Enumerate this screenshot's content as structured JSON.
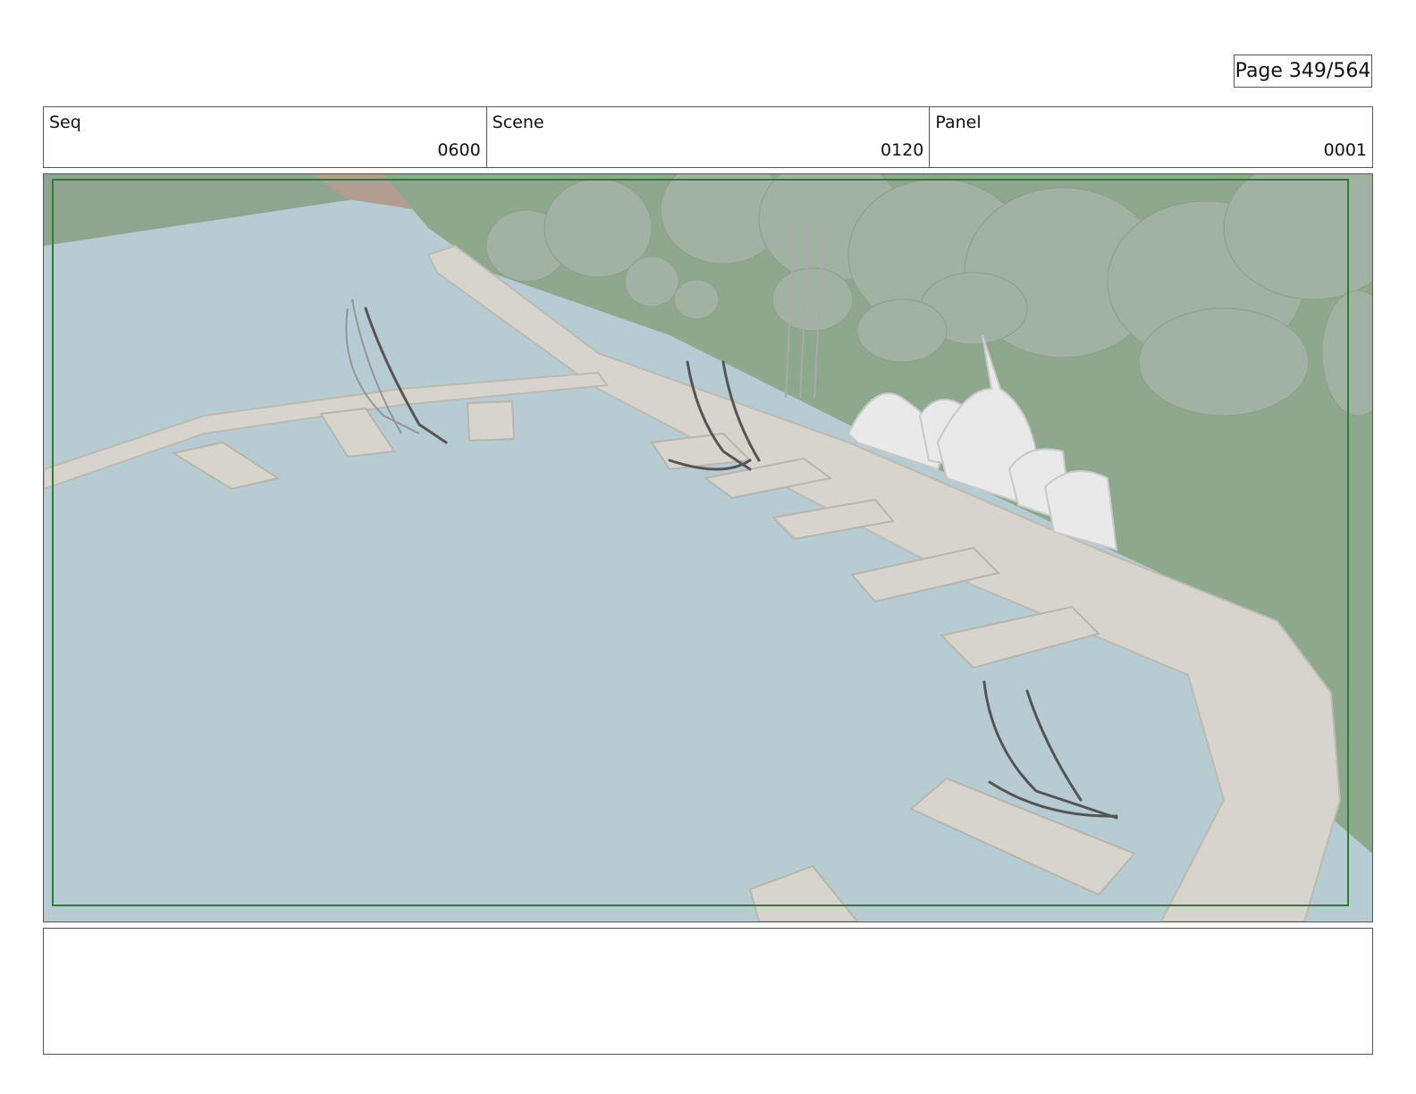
{
  "page": {
    "label": "Page 349/564"
  },
  "header": {
    "seq": {
      "label": "Seq",
      "value": "0600"
    },
    "scene": {
      "label": "Scene",
      "value": "0120"
    },
    "panel": {
      "label": "Panel",
      "value": "0001"
    }
  },
  "drawing": {
    "description_icon": "marina-storyboard-sketch",
    "colors": {
      "water": "#b6cbd2",
      "grass": "#8ea88e",
      "trees": "#a2b2a2",
      "dock": "#d6d4cc",
      "safe_frame": "#2e7d32"
    }
  },
  "notes": {
    "text": ""
  }
}
